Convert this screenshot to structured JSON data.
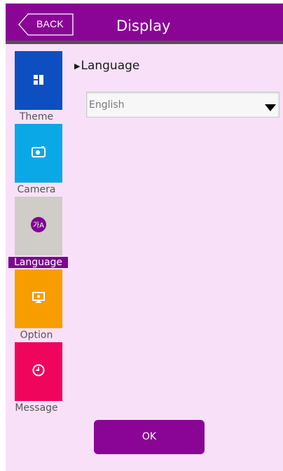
{
  "header": {
    "back_label": "BACK",
    "title": "Display"
  },
  "sidebar": {
    "items": [
      {
        "label": "Theme",
        "icon": "theme-icon",
        "color": "#0d4fc1",
        "active": false
      },
      {
        "label": "Camera",
        "icon": "camera-icon",
        "color": "#0aa8e6",
        "active": false
      },
      {
        "label": "Language",
        "icon": "language-icon",
        "color": "#d0ccc8",
        "active": true
      },
      {
        "label": "Option",
        "icon": "monitor-icon",
        "color": "#f79d00",
        "active": false
      },
      {
        "label": "Message",
        "icon": "clock-icon",
        "color": "#f0055c",
        "active": false
      }
    ]
  },
  "main": {
    "section_title": "Language",
    "language_select": {
      "value": "English"
    }
  },
  "footer": {
    "ok_label": "OK"
  },
  "colors": {
    "accent": "#8a0596",
    "background": "#f8e1f8"
  }
}
